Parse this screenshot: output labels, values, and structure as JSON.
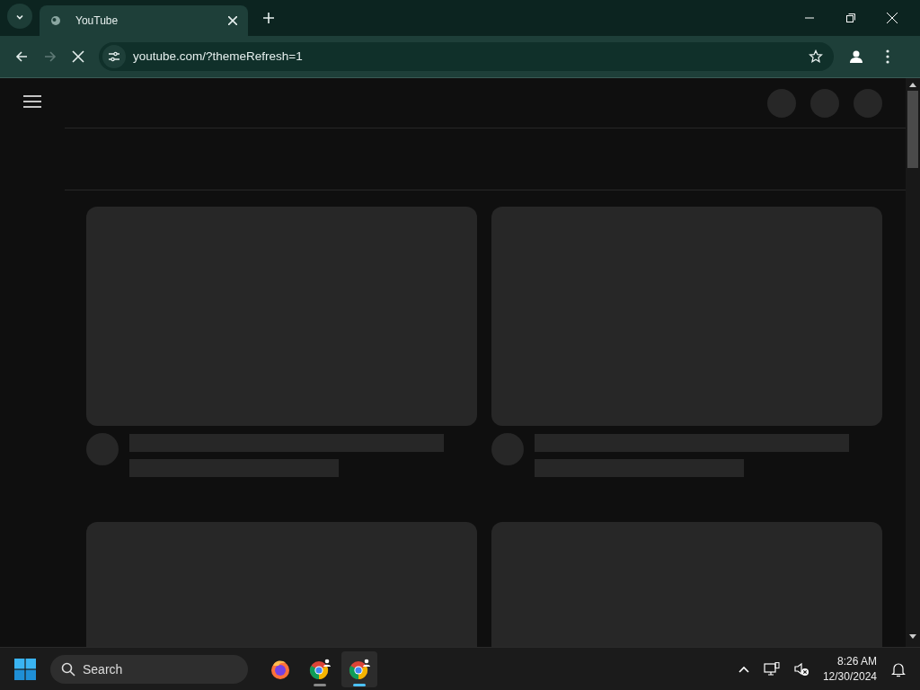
{
  "browser": {
    "tabs": [
      {
        "title": "YouTube",
        "selected": true
      }
    ],
    "address": "youtube.com/?themeRefresh=1",
    "loading": true
  },
  "page": {
    "feed_loading": true
  },
  "taskbar": {
    "search": {
      "placeholder": "Search"
    },
    "apps": [
      {
        "kind": "firefox",
        "selected": false
      },
      {
        "kind": "chrome",
        "selected": false
      },
      {
        "kind": "chrome",
        "selected": true
      }
    ],
    "time": "8:26 AM",
    "date": "12/30/2024"
  }
}
